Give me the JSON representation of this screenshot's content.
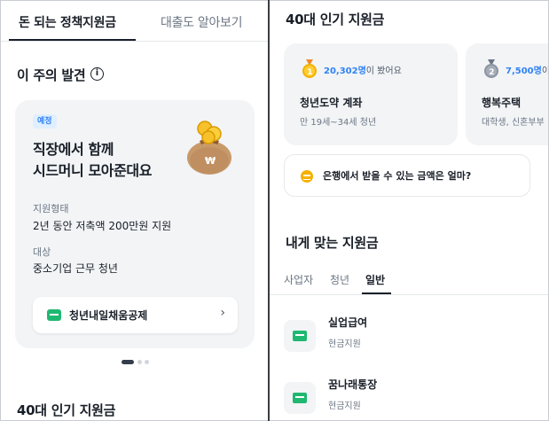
{
  "left": {
    "tabs": [
      {
        "label": "돈 되는 정책지원금"
      },
      {
        "label": "대출도 알아보기"
      }
    ],
    "section_title": "이 주의 발견",
    "info_glyph": "i",
    "feature": {
      "badge": "예정",
      "title_line1": "직장에서 함께",
      "title_line2": "시드머니 모아준대요",
      "support_type_label": "지원형태",
      "support_type_value": "2년 동안 저축액 200만원 지원",
      "target_label": "대상",
      "target_value": "중소기업 근무 청년",
      "product_label": "청년내일채움공제",
      "chevron": "›"
    },
    "carousel": {
      "pages": 3,
      "active": 1
    },
    "bottom_title": "40대 인기 지원금"
  },
  "right": {
    "title": "40대 인기 지원금",
    "popular": [
      {
        "rank": "1",
        "views_count": "20,302명",
        "views_suffix": "이 봤어요",
        "name": "청년도약 계좌",
        "desc": "만 19세~34세 청년",
        "medal_color": "#f5b100"
      },
      {
        "rank": "2",
        "views_count": "7,500명",
        "views_suffix": "이",
        "name": "행복주택",
        "desc": "대학생, 신혼부부",
        "medal_color": "#8b95a1"
      }
    ],
    "bank_question": "은행에서 받을 수 있는 금액은 얼마?",
    "match_title": "내게 맞는 지원금",
    "segment_tabs": [
      {
        "label": "사업자"
      },
      {
        "label": "청년"
      },
      {
        "label": "일반"
      }
    ],
    "active_segment": "일반",
    "list": [
      {
        "name": "실업급여",
        "type": "현금지원"
      },
      {
        "name": "꿈나래통장",
        "type": "현금지원"
      }
    ]
  },
  "colors": {
    "accent_blue": "#3182f6",
    "money_green": "#1fb871",
    "gold": "#f5b100",
    "card_bg": "#f2f4f6"
  }
}
